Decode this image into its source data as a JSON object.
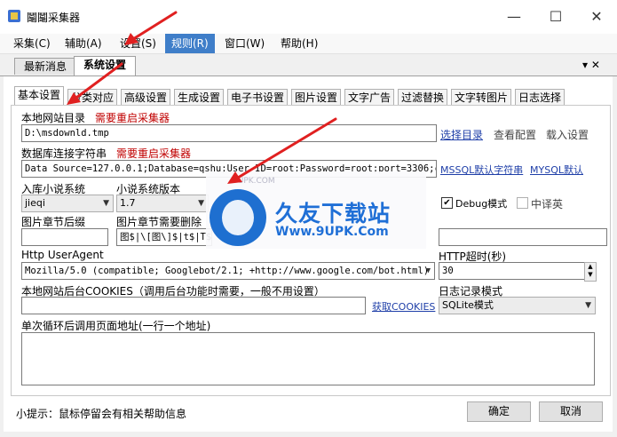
{
  "window": {
    "title": "鬮鬮采集器",
    "minimize": "—",
    "maximize": "☐",
    "close": "✕"
  },
  "menu": [
    "采集(C)",
    "辅助(A)",
    "设置(S)",
    "规则(R)",
    "窗口(W)",
    "帮助(H)"
  ],
  "doc_tabs": [
    "最新消息",
    "系统设置"
  ],
  "doc_tab_menu": "▾ ✕",
  "settings_tabs": [
    "基本设置",
    "分类对应",
    "高级设置",
    "生成设置",
    "电子书设置",
    "图片设置",
    "文字广告",
    "过滤替换",
    "文字转图片",
    "日志选择"
  ],
  "local_dir": {
    "label": "本地网站目录",
    "warning": "需要重启采集器",
    "value": "D:\\msdownld.tmp",
    "choose": "选择目录",
    "view": "查看配置",
    "load": "载入设置"
  },
  "db": {
    "label": "数据库连接字符串",
    "warning": "需要重启采集器",
    "value": "Data Source=127.0.0.1;Database=qshu;User ID=root;Password=root;port=3306;cha",
    "mssql": "MSSQL默认字符串",
    "mysql": "MYSQL默认"
  },
  "novel": {
    "system_label": "入库小说系统",
    "system_value": "jieqi",
    "version_label": "小说系统版本",
    "version_value": "1.7"
  },
  "debug": {
    "label": "Debug模式",
    "checked": true
  },
  "translate": {
    "label": "中译英",
    "checked": false
  },
  "pic": {
    "suffix_label": "图片章节后缀",
    "suffix_value": "",
    "delete_label": "图片章节需要删除",
    "delete_value": "图$|\\[图\\]$|t$|T$"
  },
  "ua": {
    "label": "Http UserAgent",
    "value": "Mozilla/5.0 (compatible; Googlebot/2.1; +http://www.google.com/bot.html)"
  },
  "timeout": {
    "label": "HTTP超时(秒)",
    "value": "30"
  },
  "cookies": {
    "label": "本地网站后台COOKIES（调用后台功能时需要，一般不用设置）",
    "value": "",
    "fetch": "获取COOKIES"
  },
  "log": {
    "label": "日志记录模式",
    "value": "SQLite模式"
  },
  "loop": {
    "label": "单次循环后调用页面地址(一行一个地址)",
    "value": ""
  },
  "tip": "小提示：鼠标停留会有相关帮助信息",
  "buttons": {
    "ok": "确定",
    "cancel": "取消"
  },
  "watermark": {
    "brand": "久友下载站",
    "url": "Www.9UPK.Com",
    "faint": "9UPK.COM"
  },
  "colors": {
    "accent": "#3f7ec9",
    "warning": "#c00000",
    "link": "#1f3fa8",
    "arrow": "#e02020"
  }
}
